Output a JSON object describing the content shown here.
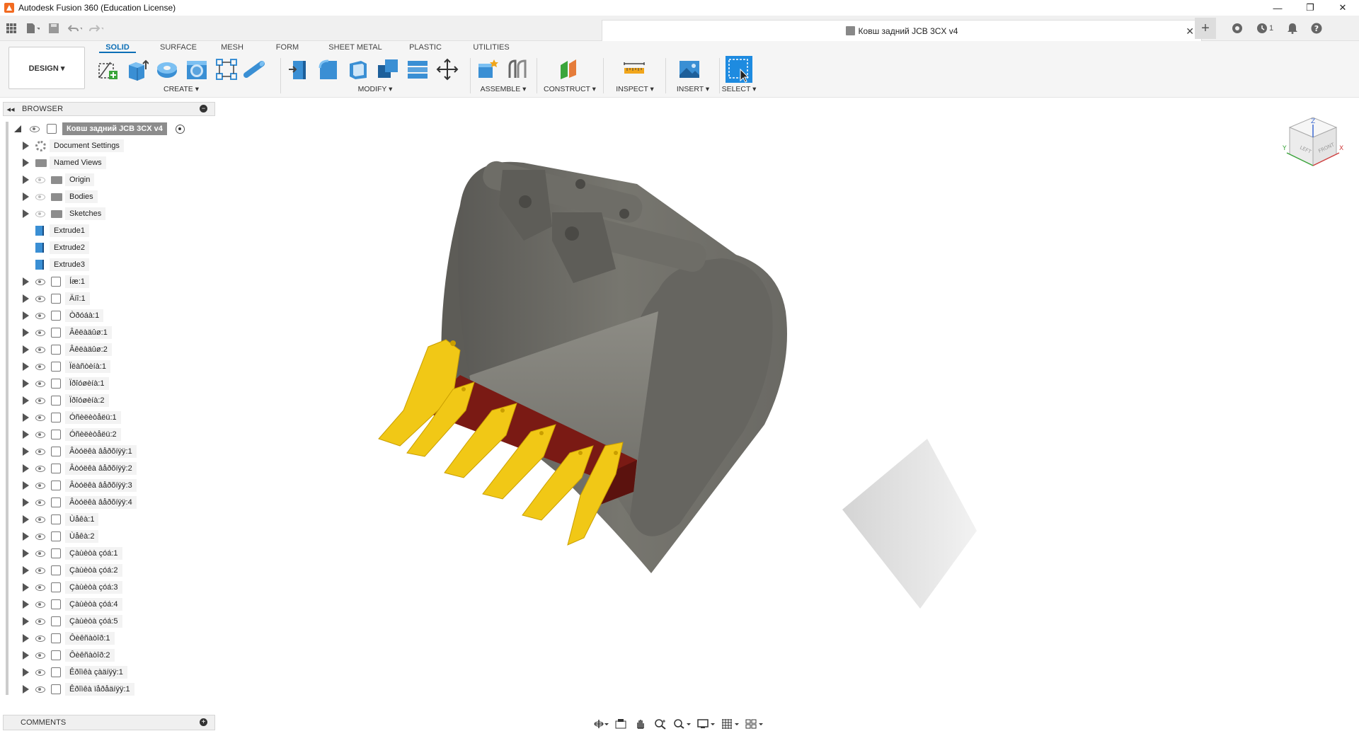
{
  "window": {
    "title": "Autodesk Fusion 360 (Education License)",
    "minimize": "—",
    "restore": "❐",
    "close": "✕"
  },
  "tabbar": {
    "doc_title": "Ковш задний JCB 3CX v4",
    "doc_close": "✕",
    "jobs_count": "1"
  },
  "toolbar": {
    "workspace": "DESIGN ▾",
    "tabs": [
      "SOLID",
      "SURFACE",
      "MESH",
      "FORM",
      "SHEET METAL",
      "PLASTIC",
      "UTILITIES"
    ],
    "groups": {
      "create": "CREATE ▾",
      "modify": "MODIFY ▾",
      "assemble": "ASSEMBLE ▾",
      "construct": "CONSTRUCT ▾",
      "inspect": "INSPECT ▾",
      "insert": "INSERT ▾",
      "select": "SELECT ▾"
    }
  },
  "browser": {
    "title": "BROWSER",
    "root": "Ковш задний JCB 3CX v4",
    "items": [
      {
        "label": "Document Settings",
        "icon": "gear-icon"
      },
      {
        "label": "Named Views",
        "icon": "folder-icon"
      },
      {
        "label": "Origin",
        "icon": "folder-icon"
      },
      {
        "label": "Bodies",
        "icon": "folder-icon"
      },
      {
        "label": "Sketches",
        "icon": "folder-icon"
      },
      {
        "label": "Extrude1",
        "icon": "extrude-icon"
      },
      {
        "label": "Extrude2",
        "icon": "extrude-icon"
      },
      {
        "label": "Extrude3",
        "icon": "extrude-icon"
      },
      {
        "label": "Íæ:1",
        "icon": "component-icon"
      },
      {
        "label": "Äíî:1",
        "icon": "component-icon"
      },
      {
        "label": "Òðóáà:1",
        "icon": "component-icon"
      },
      {
        "label": "Âêëàäûø:1",
        "icon": "component-icon"
      },
      {
        "label": "Âêëàäûø:2",
        "icon": "component-icon"
      },
      {
        "label": "Ïëàñòèíà:1",
        "icon": "component-icon"
      },
      {
        "label": "Ïðîóøèíà:1",
        "icon": "component-icon"
      },
      {
        "label": "Ïðîóøèíà:2",
        "icon": "component-icon"
      },
      {
        "label": "Óñèëèòåëü:1",
        "icon": "component-icon"
      },
      {
        "label": "Óñèëèòåëü:2",
        "icon": "component-icon"
      },
      {
        "label": "Âòóëêà âåðõíÿÿ:1",
        "icon": "component-icon"
      },
      {
        "label": "Âòóëêà âåðõíÿÿ:2",
        "icon": "component-icon"
      },
      {
        "label": "Âòóëêà âåðõíÿÿ:3",
        "icon": "component-icon"
      },
      {
        "label": "Âòóëêà âåðõíÿÿ:4",
        "icon": "component-icon"
      },
      {
        "label": "Ùåêà:1",
        "icon": "component-icon"
      },
      {
        "label": "Ùåêà:2",
        "icon": "component-icon"
      },
      {
        "label": "Çàùèòà çóá:1",
        "icon": "component-icon"
      },
      {
        "label": "Çàùèòà çóá:2",
        "icon": "component-icon"
      },
      {
        "label": "Çàùèòà çóá:3",
        "icon": "component-icon"
      },
      {
        "label": "Çàùèòà çóá:4",
        "icon": "component-icon"
      },
      {
        "label": "Çàùèòà çóá:5",
        "icon": "component-icon"
      },
      {
        "label": "Ôèêñàòîð:1",
        "icon": "component-icon"
      },
      {
        "label": "Ôèêñàòîð:2",
        "icon": "component-icon"
      },
      {
        "label": "Êðîìêà çàäíÿÿ:1",
        "icon": "component-icon"
      },
      {
        "label": "Êðîìêà ïåðåäíÿÿ:1",
        "icon": "component-icon"
      }
    ]
  },
  "comments": {
    "title": "COMMENTS"
  },
  "viewcube": {
    "left": "LEFT",
    "front": "FRONT",
    "z": "Z",
    "x": "X",
    "y": "Y"
  },
  "colors": {
    "accent": "#0c6eb6",
    "bucket_body": "#6f6e69",
    "teeth": "#f1c816",
    "cutting_edge": "#7a1a14"
  }
}
